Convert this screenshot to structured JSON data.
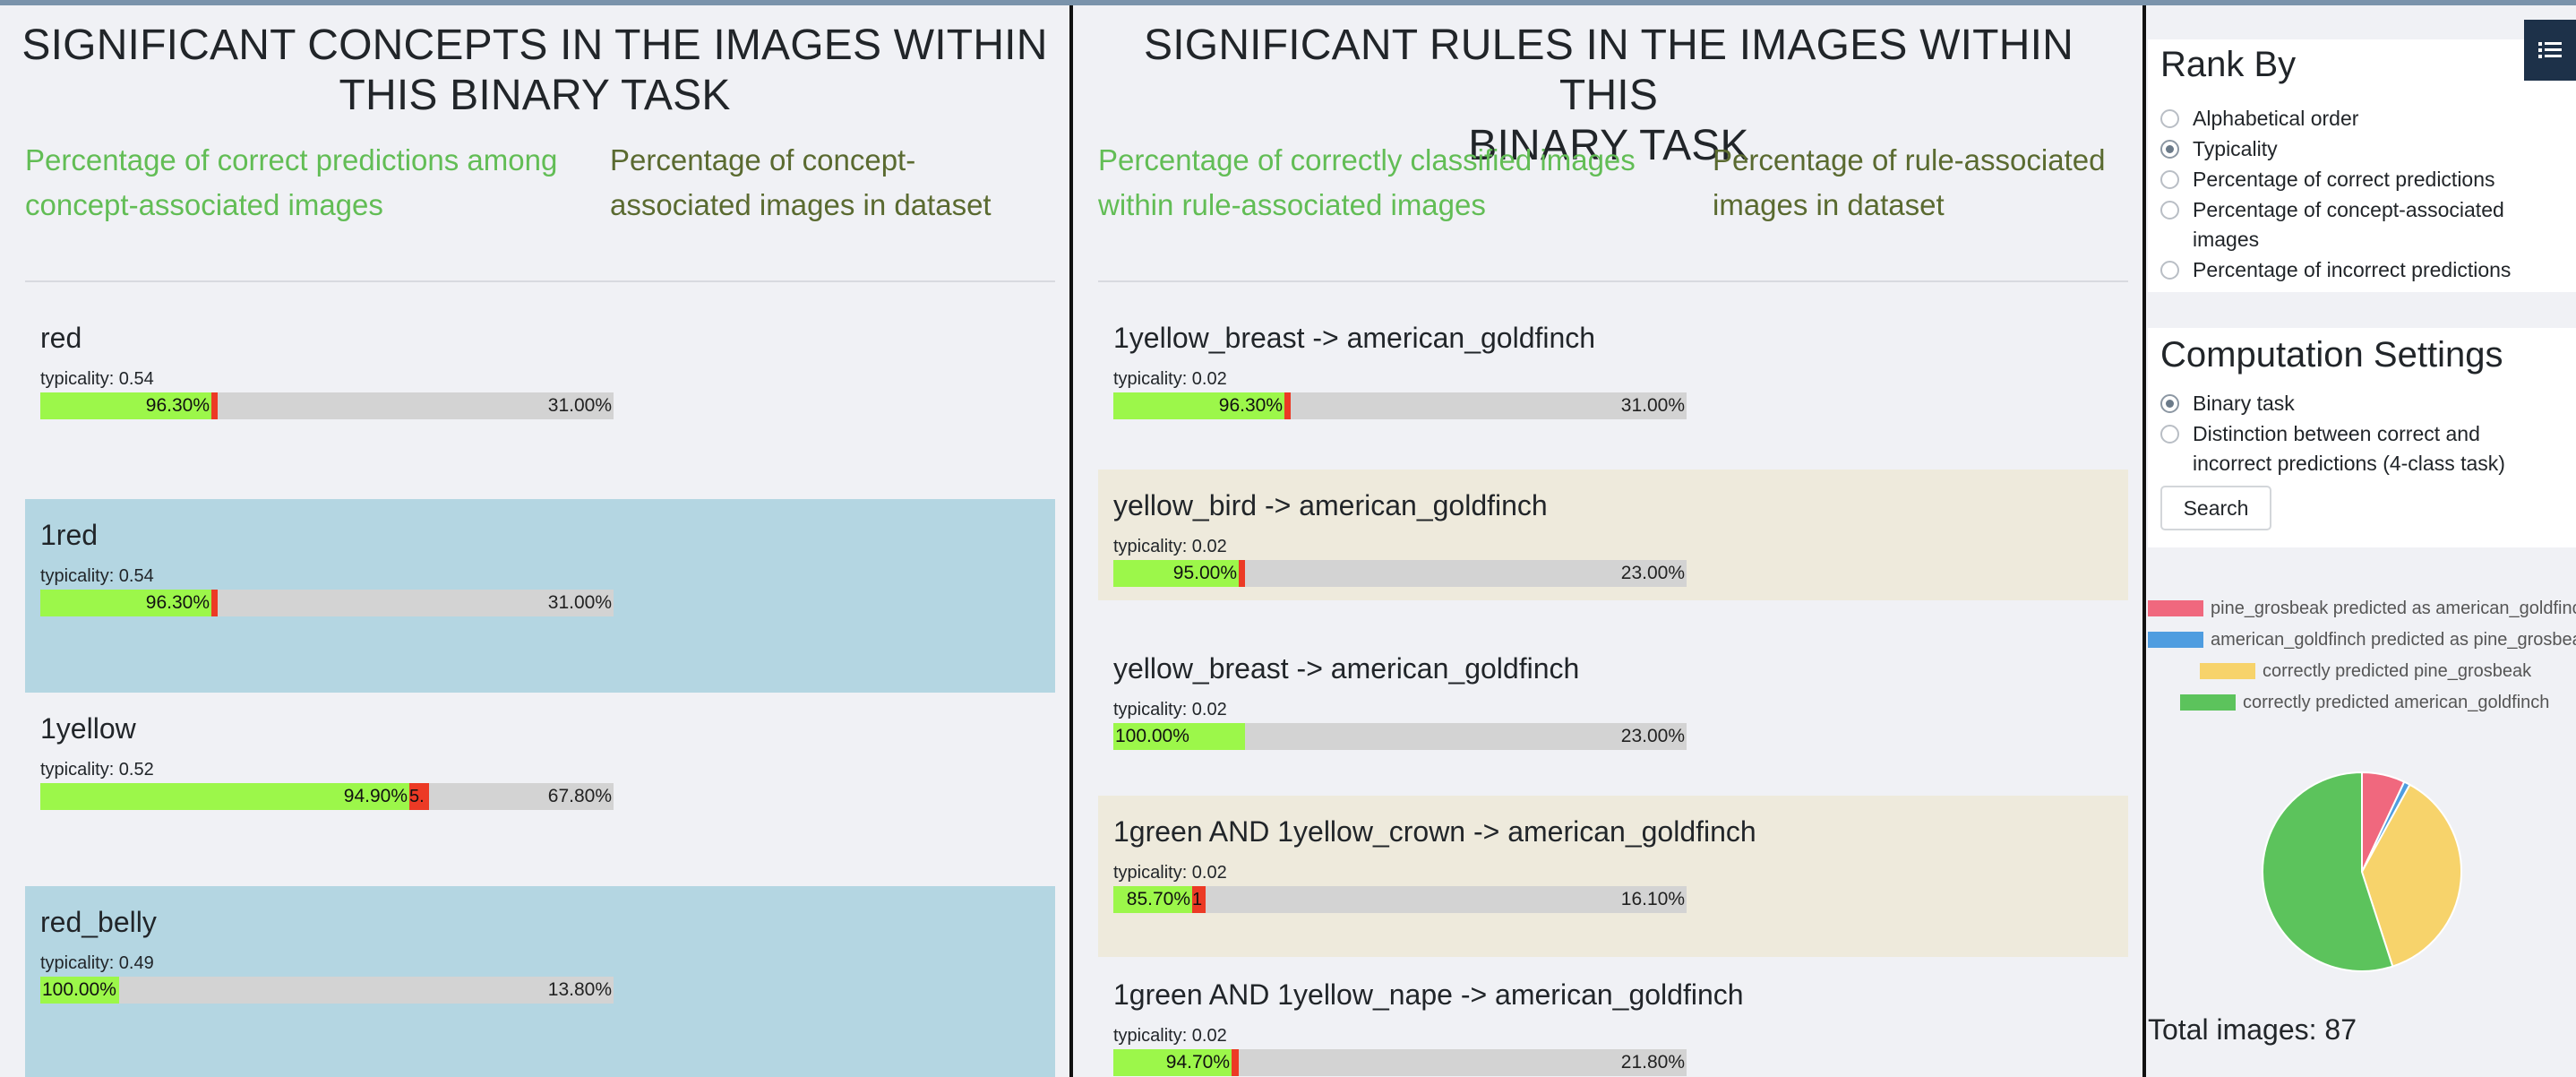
{
  "concepts_panel": {
    "title_line1": "SIGNIFICANT CONCEPTS IN THE IMAGES WITHIN",
    "title_line2": "THIS BINARY TASK",
    "legend_correct_line1": "Percentage of correct predictions among",
    "legend_correct_line2": "concept-associated images",
    "legend_dataset_line1": "Percentage of concept-",
    "legend_dataset_line2": "associated images in dataset",
    "items": [
      {
        "label": "red",
        "typicality": "typicality: 0.54",
        "correct_pct": 96.3,
        "correct_label": "96.30%",
        "incorrect_label": "",
        "dataset_label": "31.00%",
        "dataset_fraction": 0.31,
        "highlighted": false
      },
      {
        "label": "1red",
        "typicality": "typicality: 0.54",
        "correct_pct": 96.3,
        "correct_label": "96.30%",
        "incorrect_label": "",
        "dataset_label": "31.00%",
        "dataset_fraction": 0.31,
        "highlighted": true
      },
      {
        "label": "1yellow",
        "typicality": "typicality: 0.52",
        "correct_pct": 94.9,
        "correct_label": "94.90%",
        "incorrect_label": "5.",
        "dataset_label": "67.80%",
        "dataset_fraction": 0.678,
        "highlighted": false
      },
      {
        "label": "red_belly",
        "typicality": "typicality: 0.49",
        "correct_pct": 100.0,
        "correct_label": "100.00%",
        "incorrect_label": "",
        "dataset_label": "13.80%",
        "dataset_fraction": 0.138,
        "highlighted": true
      }
    ]
  },
  "rules_panel": {
    "title_line1": "SIGNIFICANT RULES IN THE IMAGES WITHIN THIS",
    "title_line2": "BINARY TASK",
    "legend_correct_line1": "Percentage of correctly classified images",
    "legend_correct_line2": "within rule-associated images",
    "legend_dataset_line1": "Percentage of rule-associated",
    "legend_dataset_line2": "images in dataset",
    "items": [
      {
        "label": "1yellow_breast -> american_goldfinch",
        "typicality": "typicality: 0.02",
        "correct_pct": 96.3,
        "correct_label": "96.30%",
        "incorrect_label": "",
        "dataset_label": "31.00%",
        "dataset_fraction": 0.31,
        "highlighted": false
      },
      {
        "label": "yellow_bird -> american_goldfinch",
        "typicality": "typicality: 0.02",
        "correct_pct": 95.0,
        "correct_label": "95.00%",
        "incorrect_label": "",
        "dataset_label": "23.00%",
        "dataset_fraction": 0.23,
        "highlighted": true
      },
      {
        "label": "yellow_breast -> american_goldfinch",
        "typicality": "typicality: 0.02",
        "correct_pct": 100.0,
        "correct_label": "100.00%",
        "incorrect_label": "",
        "dataset_label": "23.00%",
        "dataset_fraction": 0.23,
        "highlighted": false
      },
      {
        "label": "1green AND 1yellow_crown -> american_goldfinch",
        "typicality": "typicality: 0.02",
        "correct_pct": 85.7,
        "correct_label": "85.70%",
        "incorrect_label": "1",
        "dataset_label": "16.10%",
        "dataset_fraction": 0.161,
        "highlighted": true
      },
      {
        "label": "1green AND 1yellow_nape -> american_goldfinch",
        "typicality": "typicality: 0.02",
        "correct_pct": 94.7,
        "correct_label": "94.70%",
        "incorrect_label": "",
        "dataset_label": "21.80%",
        "dataset_fraction": 0.218,
        "highlighted": false
      }
    ]
  },
  "sidebar": {
    "rank_by": {
      "title": "Rank By",
      "options": [
        {
          "lines": [
            "Alphabetical order"
          ],
          "selected": false
        },
        {
          "lines": [
            "Typicality"
          ],
          "selected": true
        },
        {
          "lines": [
            "Percentage of correct predictions"
          ],
          "selected": false
        },
        {
          "lines": [
            "Percentage of concept-associated",
            "images"
          ],
          "selected": false
        },
        {
          "lines": [
            "Percentage of incorrect predictions"
          ],
          "selected": false
        }
      ]
    },
    "computation": {
      "title": "Computation Settings",
      "options": [
        {
          "lines": [
            "Binary task"
          ],
          "selected": true
        },
        {
          "lines": [
            "Distinction between correct and",
            "incorrect predictions (4-class task)"
          ],
          "selected": false
        }
      ],
      "search_label": "Search"
    },
    "menu_icon": "list-icon",
    "pie_legend": [
      {
        "label": "pine_grosbeak predicted as american_goldfinch",
        "color": "#f0687e"
      },
      {
        "label": "american_goldfinch predicted as pine_grosbeak",
        "color": "#4f9de0"
      },
      {
        "label": "correctly predicted pine_grosbeak",
        "color": "#f7d36b"
      },
      {
        "label": "correctly predicted american_goldfinch",
        "color": "#5cc35c"
      }
    ],
    "pie_values": [
      7,
      1,
      37,
      55
    ],
    "total_images": "Total images: 87"
  }
}
